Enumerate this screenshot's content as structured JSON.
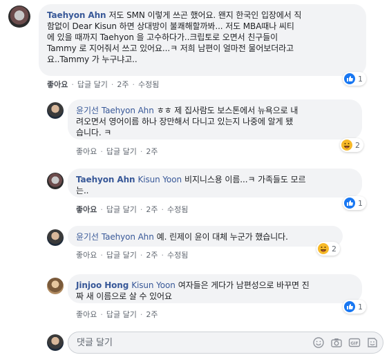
{
  "colors": {
    "link": "#385898",
    "bubble": "#f2f3f5",
    "like": "#1877f2"
  },
  "comments": [
    {
      "author": "Taehyon Ahn",
      "mention": "",
      "text_lines": [
        "저도 SMN 이렇게 쓰곤 했어요. 왠지 한국인 입장에서 직",
        "함없이 Dear Kisun 하면 상대방이 불쾌해할까봐... 저도 MBA때나 씨티",
        "에 있을 때까지 Taehyon 을 고수하다가..크립토로 오면서 친구들이",
        "Tammy 로 지어줘서 쓰고 있어요...ㅋ 저희 남편이 얼마전 물어보더라고",
        "요..Tammy 가 누구냐고.."
      ],
      "actions": {
        "like": "좋아요",
        "reply": "답글 달기",
        "time": "2주",
        "edited": "수정됨"
      },
      "reaction": {
        "icon": "like-icon",
        "count": "1"
      }
    },
    {
      "author": "윤기선",
      "mention": "Taehyon Ahn",
      "text_lines": [
        "ㅎㅎ 제 집사람도 보스톤에서 뉴욕으로 내",
        "려오면서 영어이름 하나 장만해서 다니고 있는지 나중에 알게 됐",
        "습니다. ㅋ"
      ],
      "actions": {
        "like": "좋아요",
        "reply": "답글 달기",
        "time": "2주",
        "edited": ""
      },
      "reaction": {
        "icon": "haha-icon",
        "count": "2"
      }
    },
    {
      "author": "Taehyon Ahn",
      "mention": "Kisun Yoon",
      "text_lines": [
        "비지니스용 이름...ㅋ 가족들도 모르",
        "는.."
      ],
      "actions": {
        "like": "좋아요",
        "reply": "답글 달기",
        "time": "2주",
        "edited": "수정됨"
      },
      "reaction": {
        "icon": "like-icon",
        "count": "1"
      }
    },
    {
      "author": "윤기선",
      "mention": "Taehyon Ahn",
      "text_lines": [
        "예. 린제이 윤이 대체 누군가 했습니다."
      ],
      "actions": {
        "like": "좋아요",
        "reply": "답글 달기",
        "time": "2주",
        "edited": "수정됨"
      },
      "reaction": {
        "icon": "haha-icon",
        "count": "2"
      }
    },
    {
      "author": "Jinjoo Hong",
      "mention": "Kisun Yoon",
      "text_lines": [
        "여자들은 게다가 남편성으로 바꾸면 진",
        "짜 새 이름으로 살 수 있어요"
      ],
      "actions": {
        "like": "좋아요",
        "reply": "답글 달기",
        "time": "2주",
        "edited": ""
      },
      "reaction": {
        "icon": "like-icon",
        "count": "1"
      }
    }
  ],
  "composer": {
    "placeholder": "댓글 달기",
    "icons": [
      "emoji-icon",
      "camera-icon",
      "gif-icon",
      "sticker-icon"
    ]
  }
}
